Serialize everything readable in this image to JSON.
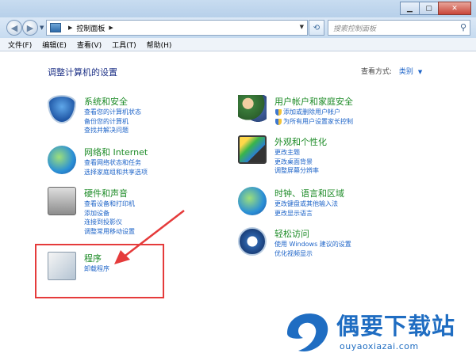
{
  "address_bar": {
    "path": [
      "控制面板"
    ],
    "search_placeholder": "搜索控制面板"
  },
  "menu": [
    "文件(F)",
    "编辑(E)",
    "查看(V)",
    "工具(T)",
    "帮助(H)"
  ],
  "page_title": "调整计算机的设置",
  "view_by": {
    "label": "查看方式:",
    "value": "类别"
  },
  "categories": [
    {
      "title": "系统和安全",
      "links": [
        "查看您的计算机状态",
        "备份您的计算机",
        "查找并解决问题"
      ]
    },
    {
      "title": "网络和 Internet",
      "links": [
        "查看网络状态和任务",
        "选择家庭组和共享选项"
      ]
    },
    {
      "title": "硬件和声音",
      "links": [
        "查看设备和打印机",
        "添加设备",
        "连接到投影仪",
        "调整常用移动设置"
      ]
    },
    {
      "title": "程序",
      "links": [
        "卸载程序"
      ]
    },
    {
      "title": "用户帐户和家庭安全",
      "links": [
        "添加或删除用户帐户",
        "为所有用户设置家长控制"
      ]
    },
    {
      "title": "外观和个性化",
      "links": [
        "更改主题",
        "更改桌面背景",
        "调整屏幕分辨率"
      ]
    },
    {
      "title": "时钟、语言和区域",
      "links": [
        "更改键盘或其他输入法",
        "更改显示语言"
      ]
    },
    {
      "title": "轻松访问",
      "links": [
        "使用 Windows 建议的设置",
        "优化视频显示"
      ]
    }
  ],
  "watermark": {
    "title": "偶要下载站",
    "url": "ouyaoxiazai.com"
  },
  "colors": {
    "category_title": "#1c8b26",
    "link": "#1e64c8",
    "highlight": "#e53b3b",
    "watermark": "#1f6dc2"
  }
}
